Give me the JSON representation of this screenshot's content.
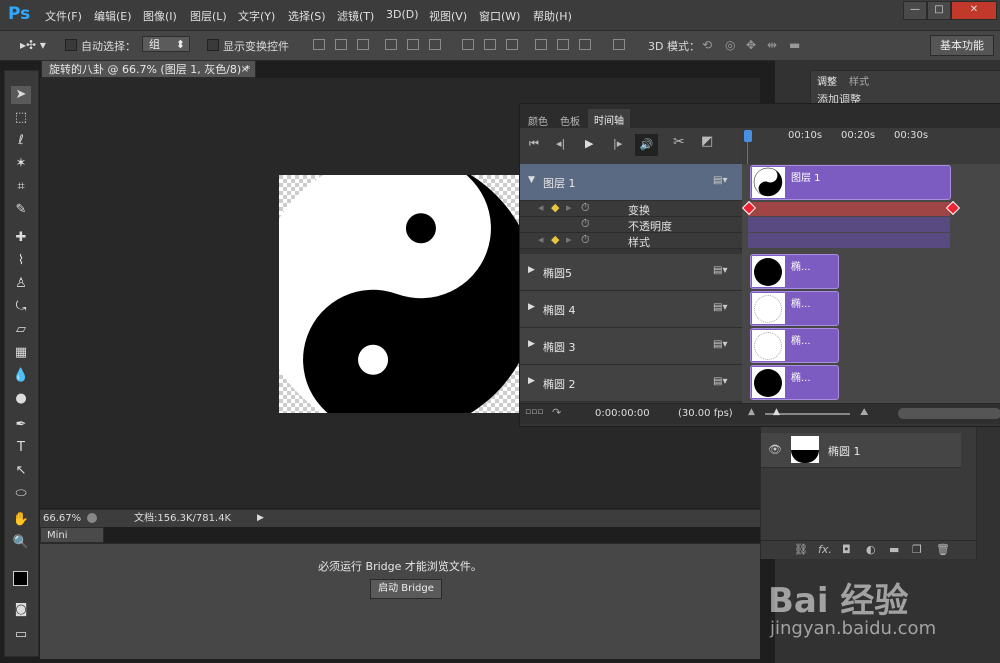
{
  "app": {
    "logo": "Ps",
    "window_buttons": [
      "—",
      "□",
      "✕"
    ]
  },
  "menu": [
    "文件(F)",
    "编辑(E)",
    "图像(I)",
    "图层(L)",
    "文字(Y)",
    "选择(S)",
    "滤镜(T)",
    "3D(D)",
    "视图(V)",
    "窗口(W)",
    "帮助(H)"
  ],
  "options": {
    "auto_select_label": "自动选择：",
    "auto_select_value": "组",
    "show_transform_label": "显示变换控件",
    "mode_3d_label": "3D 模式：",
    "workspace": "基本功能"
  },
  "document": {
    "tab_title": "旋转的八卦 @ 66.7% (图层 1, 灰色/8) *",
    "zoom": "66.67%",
    "doc_info": "文档:156.3K/781.4K"
  },
  "mini_bridge": {
    "tab": "Mini Bridge",
    "message": "必须运行 Bridge 才能浏览文件。",
    "button": "启动 Bridge"
  },
  "adjust_panel": {
    "tabs": [
      "调整",
      "样式"
    ],
    "title": "添加调整"
  },
  "timeline": {
    "tabs": [
      "颜色",
      "色板",
      "时间轴"
    ],
    "ruler": [
      "00:10s",
      "00:20s",
      "00:30s"
    ],
    "layers": [
      {
        "name": "图层 1",
        "clip_label": "图层 1",
        "expanded": true
      },
      {
        "name": "椭圆5",
        "clip_label": "椭..."
      },
      {
        "name": "椭圆 4",
        "clip_label": "椭..."
      },
      {
        "name": "椭圆 3",
        "clip_label": "椭..."
      },
      {
        "name": "椭圆 2",
        "clip_label": "椭..."
      }
    ],
    "properties": [
      "变换",
      "不透明度",
      "样式"
    ],
    "timecode": "0:00:00:00",
    "fps": "(30.00 fps)"
  },
  "layers_panel": {
    "layer_name": "椭圆 1",
    "footer_icons": [
      "link-icon",
      "fx-icon",
      "mask-icon",
      "adjustment-icon",
      "folder-icon",
      "new-layer-icon",
      "trash-icon"
    ],
    "fx_label": "fx."
  },
  "watermark": {
    "text": "Bai 经验",
    "url": "jingyan.baidu.com"
  }
}
